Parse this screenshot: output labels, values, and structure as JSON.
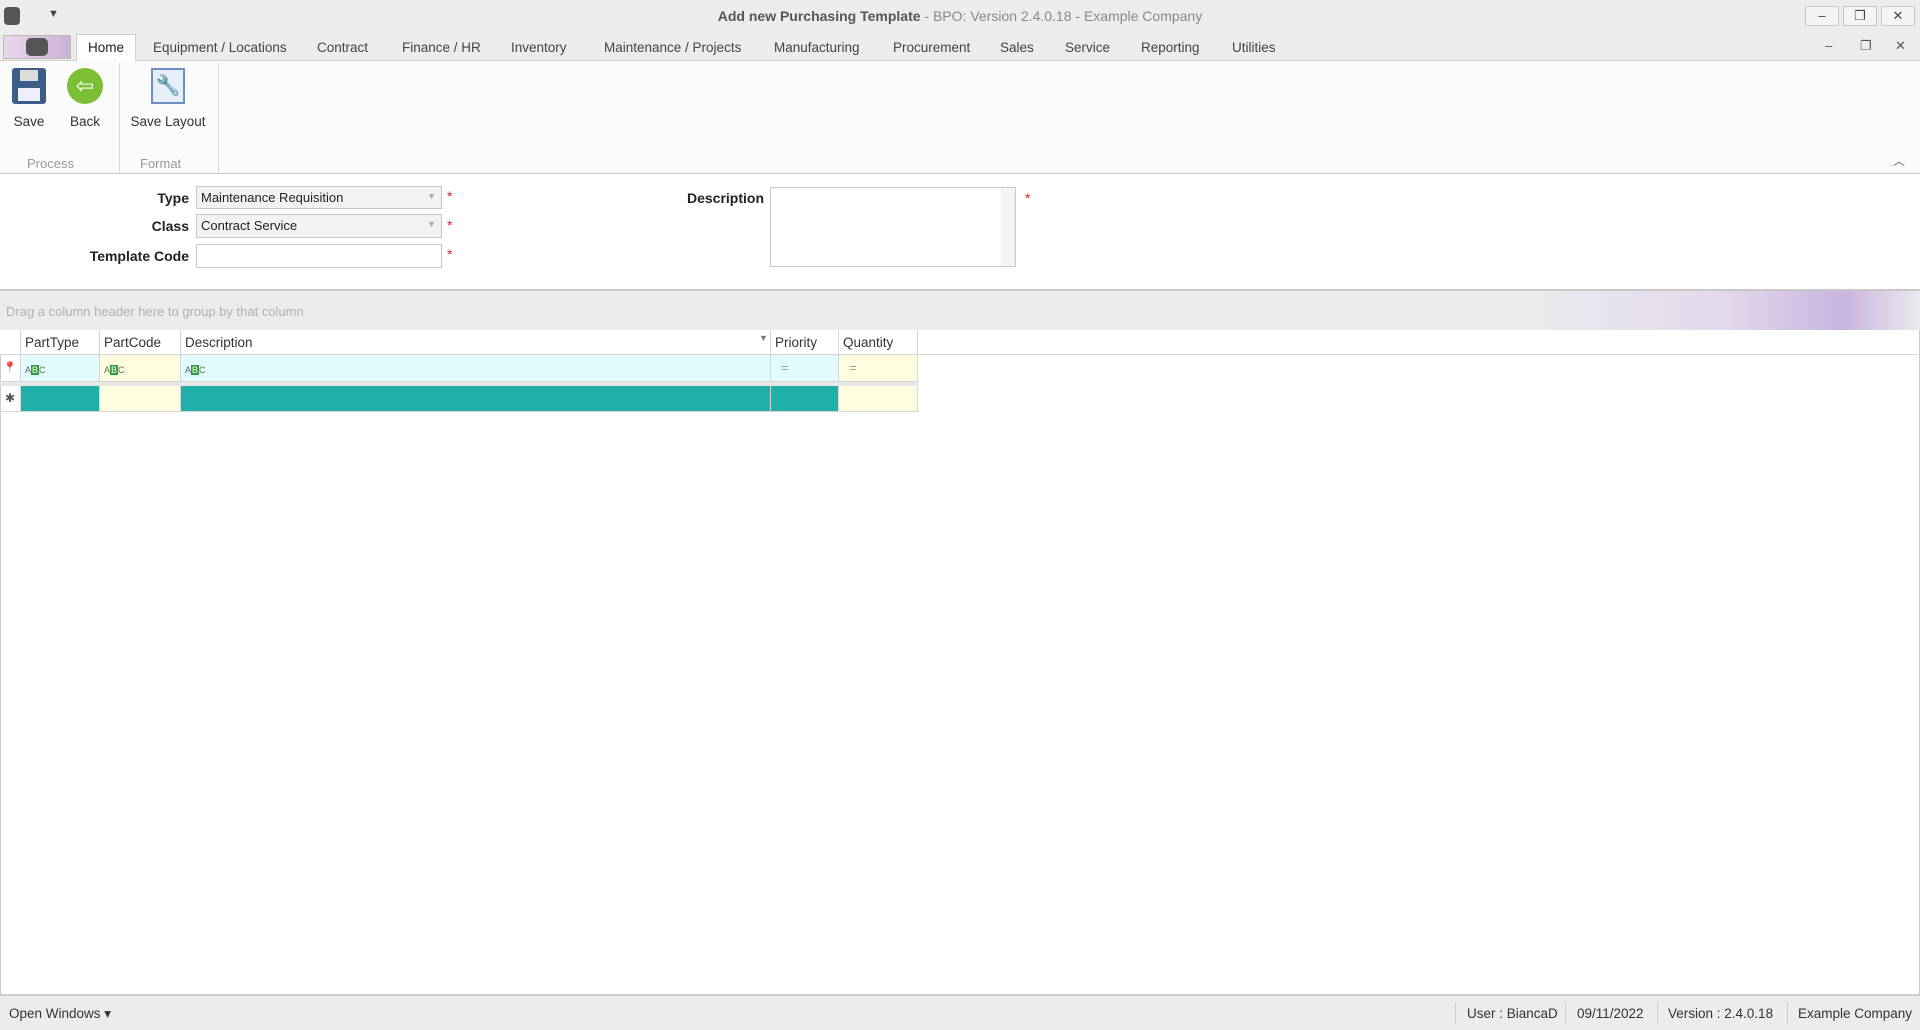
{
  "window": {
    "title": "Add new Purchasing Template",
    "subtitle": " - BPO: Version 2.4.0.18 - Example Company",
    "minimize": "–",
    "restore": "❐",
    "close": "✕"
  },
  "ribbon": {
    "tabs": [
      "Home",
      "Equipment / Locations",
      "Contract",
      "Finance / HR",
      "Inventory",
      "Maintenance / Projects",
      "Manufacturing",
      "Procurement",
      "Sales",
      "Service",
      "Reporting",
      "Utilities"
    ],
    "active_tab": "Home",
    "buttons": {
      "save": "Save",
      "back": "Back",
      "save_layout": "Save Layout"
    },
    "groups": {
      "process": "Process",
      "format": "Format"
    }
  },
  "form": {
    "type": {
      "label": "Type",
      "value": "Maintenance Requisition"
    },
    "class": {
      "label": "Class",
      "value": "Contract Service"
    },
    "template_code": {
      "label": "Template Code",
      "value": ""
    },
    "description": {
      "label": "Description",
      "value": ""
    },
    "required_mark": "*"
  },
  "grid": {
    "group_hint": "Drag a column header here to group by that column",
    "columns": [
      "PartType",
      "PartCode",
      "Description",
      "Priority",
      "Quantity"
    ],
    "filter_abc": [
      "A",
      "B",
      "C"
    ],
    "filter_eq": "="
  },
  "status": {
    "open_windows": "Open Windows ▾",
    "user": "User : BiancaD",
    "date": "09/11/2022",
    "version": "Version : 2.4.0.18",
    "company": "Example Company"
  },
  "colors": {
    "accent": "#20b0a8",
    "filter_row": "#e0fbfd",
    "yellow_cell": "#fefde0"
  }
}
